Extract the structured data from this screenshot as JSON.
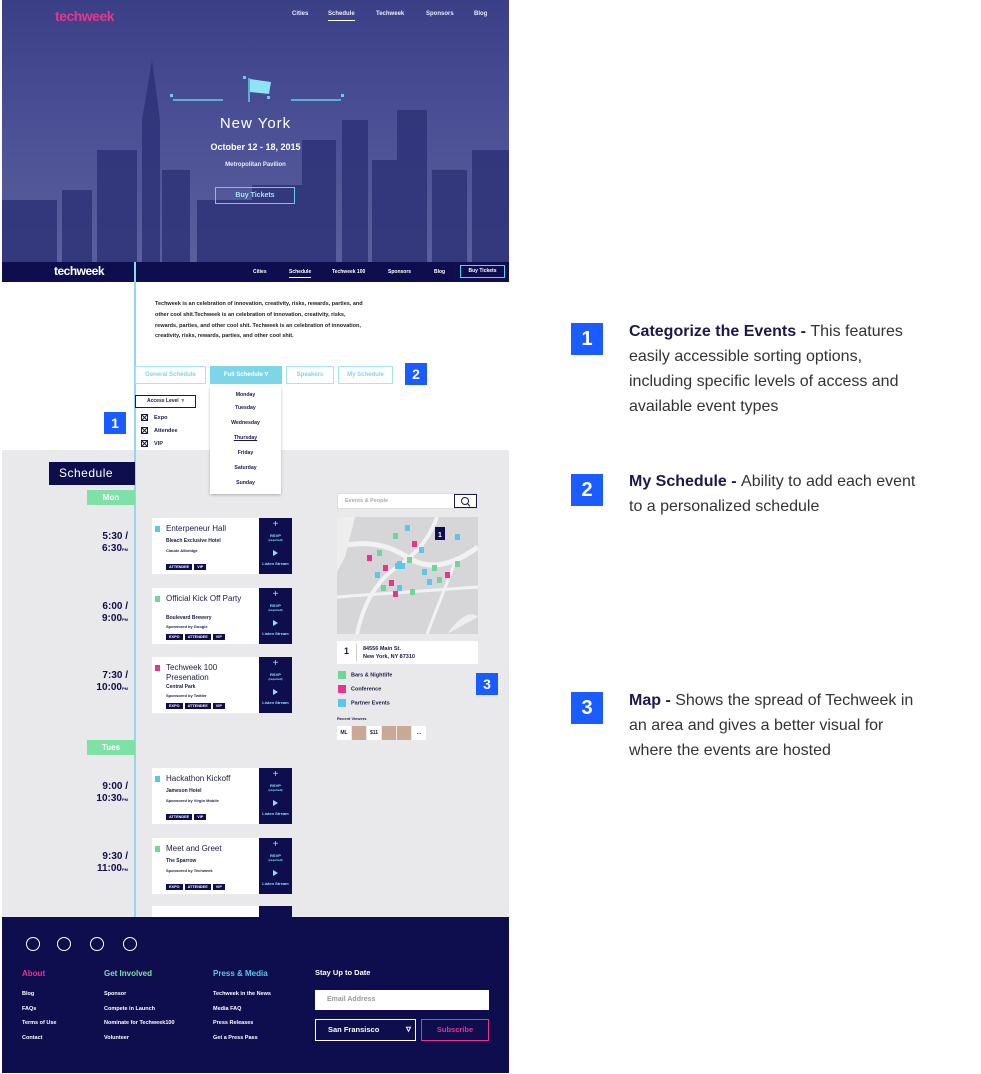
{
  "hero": {
    "logo": "techweek",
    "nav": [
      "Cities",
      "Schedule",
      "Techweek",
      "Sponsors",
      "Blog"
    ],
    "city": "New York",
    "dates": "October 12 - 18, 2015",
    "venue": "Metropolitan Pavilion",
    "buy": "Buy Tickets"
  },
  "navbar": {
    "logo": "techweek",
    "nav": [
      "Cities",
      "Schedule",
      "Techweek 100",
      "Sponsors",
      "Blog"
    ],
    "buy": "Buy Tickets"
  },
  "intro": "Techweek is an celebration of innovation, creativity, risks, rewards, parties, and other cool shit.Techweek is an celebration of innovation, creativity, risks, rewards, parties, and other cool shit. Techweek is an celebration of innovation, creativity, risks, rewards, parties, and other cool shit.",
  "filters": {
    "tabs": [
      "General Schedule",
      "Full Schedule",
      "Speakers",
      "My Schedule"
    ],
    "dropdown_arrow": "▿",
    "access": "Access Level",
    "access_arrow": "▿",
    "checks": [
      "Expo",
      "Attendee",
      "VIP"
    ],
    "days": [
      "Monday",
      "Tuesday",
      "Wednesday",
      "Thursday",
      "Friday",
      "Saturday",
      "Sunday"
    ]
  },
  "badges": {
    "one": "1",
    "two": "2",
    "three": "3"
  },
  "schedule": {
    "title": "Schedule",
    "day1": "Mon",
    "day2": "Tues",
    "events": [
      {
        "time1": "5:30 /",
        "time2": "6:30",
        "ampm": "PM",
        "title": "Enterpeneur Hall",
        "venue": "Bleach Exclusive Hotel",
        "sponsor": "Claude Allbridge",
        "tags": [
          "ATTENDEE",
          "VIP"
        ],
        "color": "#59c8e8"
      },
      {
        "time1": "6:00 /",
        "time2": "9:00",
        "ampm": "PM",
        "title": "Official Kick Off Party",
        "venue": "Boulevard Brewery",
        "sponsor": "Sponsored by Google",
        "tags": [
          "EXPO",
          "ATTENDEE",
          "VIP"
        ],
        "color": "#6fd69a"
      },
      {
        "time1": "7:30 /",
        "time2": "10:00",
        "ampm": "PM",
        "title": "Techweek 100 Presenation",
        "venue": "Central Park",
        "sponsor": "Sponsored by Twitter",
        "tags": [
          "EXPO",
          "ATTENDEE",
          "VIP"
        ],
        "color": "#e8358b"
      },
      {
        "time1": "9:00 /",
        "time2": "10:30",
        "ampm": "PM",
        "title": "Hackathon Kickoff",
        "venue": "Jameson Hotel",
        "sponsor": "Sponsored by Virgin Mobile",
        "tags": [
          "ATTENDEE",
          "VIP"
        ],
        "color": "#59c8e8"
      },
      {
        "time1": "9:30 /",
        "time2": "11:00",
        "ampm": "PM",
        "title": "Meet and Greet",
        "venue": "The Sparrow",
        "sponsor": "Sponsored by Techweek",
        "tags": [
          "EXPO",
          "ATTENDEE",
          "VIP"
        ],
        "color": "#6fd69a"
      }
    ],
    "rsvp_icon": "+",
    "rsvp": "RSVP",
    "rsvp_sub": "(required)",
    "listen": "Listen Stream"
  },
  "map": {
    "search_placeholder": "Events & People",
    "address_num": "1",
    "address1": "84556 Main St.",
    "address2": "New York, NY 87310",
    "legend": [
      {
        "label": "Bars & Nightlife",
        "color": "#6fd69a"
      },
      {
        "label": "Conference",
        "color": "#e8358b"
      },
      {
        "label": "Partner Events",
        "color": "#59c8e8"
      }
    ],
    "recent": "Recent Viewers",
    "avatars": [
      "ML",
      "",
      "$11",
      "",
      "",
      "..."
    ]
  },
  "footer": {
    "cols": [
      {
        "title": "About",
        "color": "#e8358b",
        "links": [
          "Blog",
          "FAQs",
          "Terms of Use",
          "Contact"
        ]
      },
      {
        "title": "Get Involved",
        "color": "#7ee2a8",
        "links": [
          "Sponsor",
          "Compete in Launch",
          "Nominate for Techweek100",
          "Volunteer"
        ]
      },
      {
        "title": "Press & Media",
        "color": "#59c8e8",
        "links": [
          "Techweek in the News",
          "Media FAQ",
          "Press Releases",
          "Get a Press Pass"
        ]
      }
    ],
    "stay": "Stay Up to Date",
    "email": "Email Address",
    "city": "San Fransisco",
    "city_arrow": "▿",
    "subscribe": "Subscribe"
  },
  "notes": [
    {
      "num": "1",
      "title": "Categorize the Events - ",
      "text": "This features easily accessible sorting options, including specific levels of access and available event types"
    },
    {
      "num": "2",
      "title": "My Schedule - ",
      "text": "Ability to add each event to a personalized schedule"
    },
    {
      "num": "3",
      "title": "Map - ",
      "text": "Shows the spread of Techweek in an area and gives a better visual for where the events are hosted"
    }
  ]
}
